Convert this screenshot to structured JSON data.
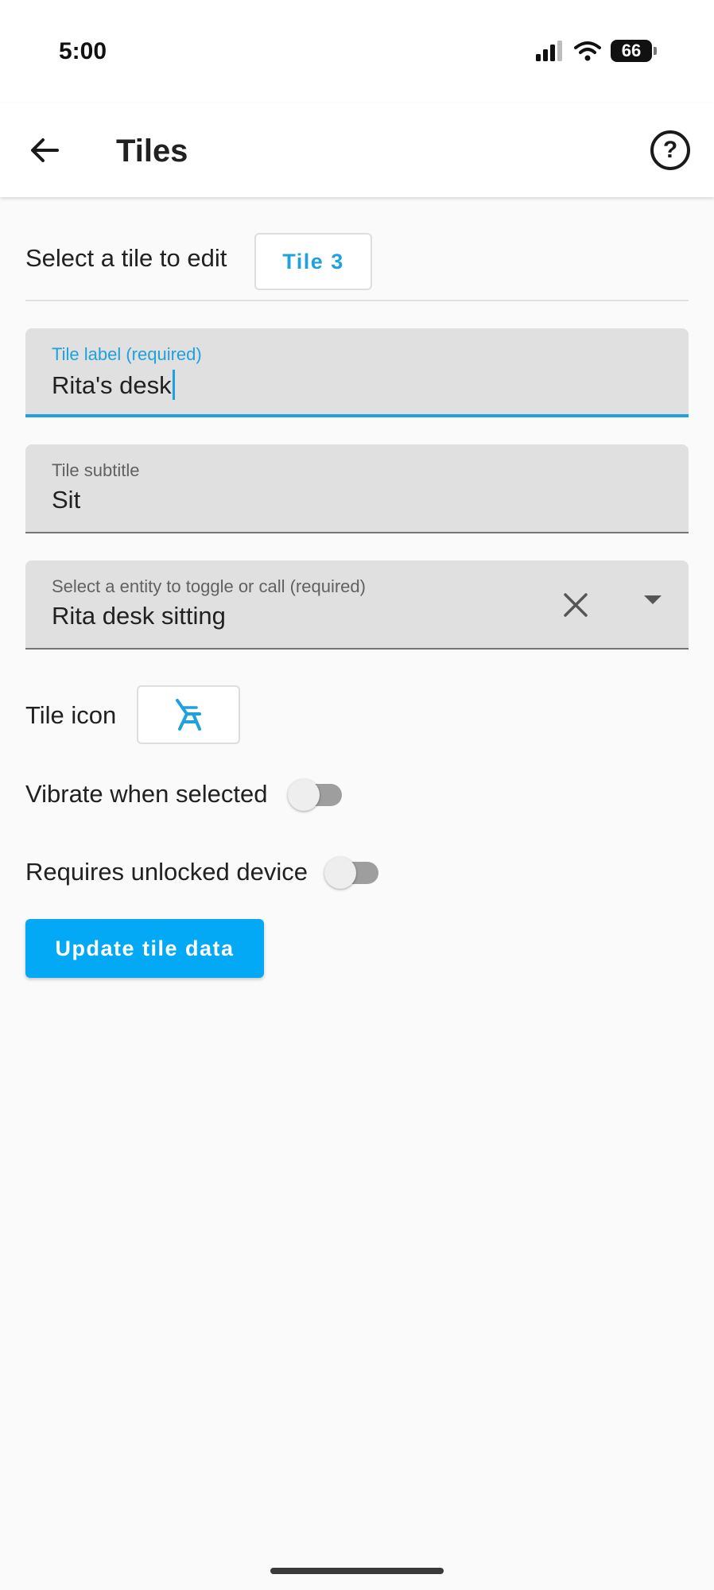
{
  "status_bar": {
    "time": "5:00",
    "battery": "66"
  },
  "app_bar": {
    "title": "Tiles",
    "back_icon": "arrow-back-icon",
    "help_icon": "help-circle-icon",
    "help_glyph": "?"
  },
  "tile_select": {
    "label": "Select a tile to edit",
    "value": "Tile 3"
  },
  "fields": {
    "tile_label": {
      "label": "Tile label (required)",
      "value": "Rita's desk"
    },
    "tile_subtitle": {
      "label": "Tile subtitle",
      "value": "Sit"
    },
    "entity": {
      "label": "Select a entity to toggle or call (required)",
      "value": "Rita desk sitting",
      "clear_icon": "close-icon",
      "dropdown_icon": "dropdown-arrow-icon"
    }
  },
  "tile_icon": {
    "label": "Tile icon",
    "icon": "chair-icon",
    "color": "#1ea1dd"
  },
  "switches": {
    "vibrate": {
      "label": "Vibrate when selected",
      "on": false
    },
    "requires_unlocked": {
      "label": "Requires unlocked device",
      "on": false
    }
  },
  "update_button": {
    "label": "Update tile data"
  },
  "colors": {
    "accent": "#1ea1dd",
    "button": "#03a9f4",
    "field_bg": "#e0e0e0"
  }
}
